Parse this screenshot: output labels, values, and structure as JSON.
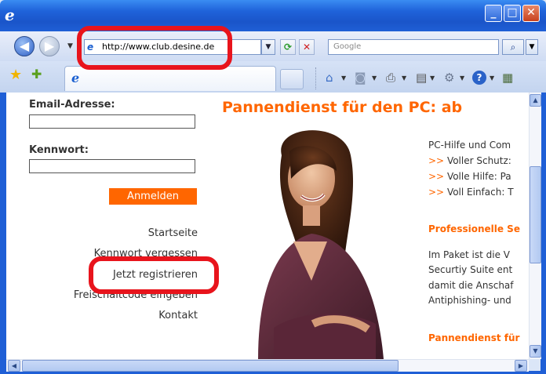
{
  "browser": {
    "address_url": "http://www.club.desine.de",
    "search_placeholder": "Google"
  },
  "icons": {
    "ie_logo": "e",
    "back": "◀",
    "forward": "▶",
    "refresh": "⟳",
    "stop": "✕",
    "search": "⌕",
    "favorites_star": "★",
    "add_favorite": "✚",
    "home": "⌂",
    "feeds": "◙",
    "print": "⎙",
    "page": "▤",
    "tools": "⚙",
    "help": "?",
    "research": "▦",
    "minimize": "_",
    "maximize": "□",
    "close": "✕",
    "dropdown": "▼"
  },
  "colors": {
    "accent": "#ff6600",
    "highlight_ring": "#e8141c",
    "titlebar": "#1f5fd6"
  },
  "login": {
    "email_label": "Email-Adresse:",
    "password_label": "Kennwort:",
    "submit_label": "Anmelden"
  },
  "nav": {
    "home": "Startseite",
    "forgot_password": "Kennwort vergessen",
    "register": "Jetzt registrieren",
    "unlock_code": "Freischaltcode eingeben",
    "contact": "Kontakt"
  },
  "main": {
    "headline": "Pannendienst für den PC: ab",
    "intro": "PC-Hilfe und Com",
    "arrow": ">>",
    "bullets": [
      "Voller Schutz:",
      "Volle Hilfe: Pa",
      "Voll Einfach: T"
    ],
    "subhead1": "Professionelle Se",
    "para": [
      "Im Paket ist die V",
      "Securtiy Suite ent",
      "damit die Anschaf",
      "Antiphishing- und"
    ],
    "subhead2": "Pannendienst für"
  }
}
